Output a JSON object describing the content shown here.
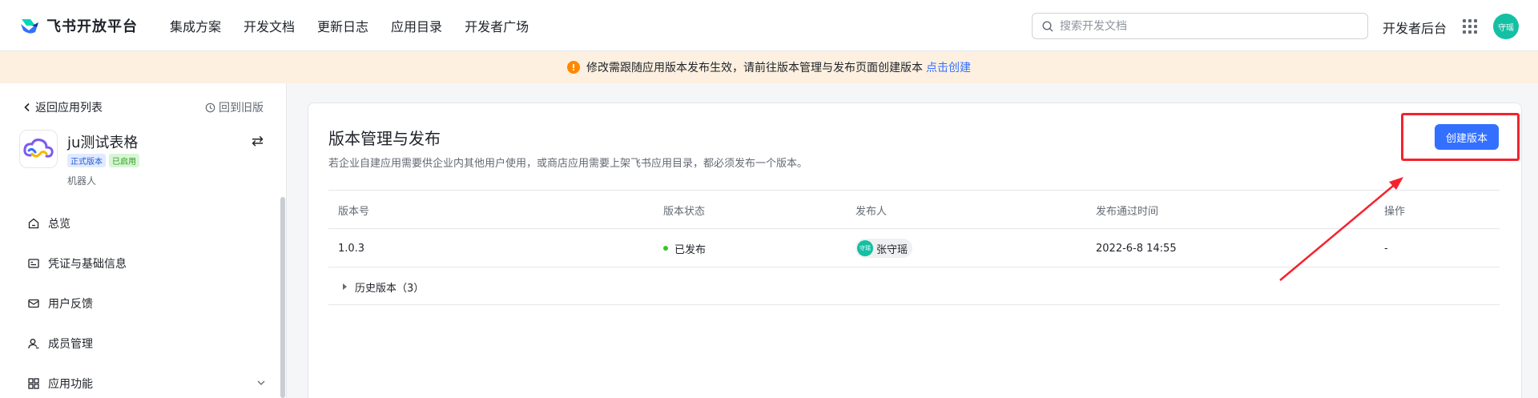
{
  "topbar": {
    "brand": "飞书开放平台",
    "nav": [
      "集成方案",
      "开发文档",
      "更新日志",
      "应用目录",
      "开发者广场"
    ],
    "search_placeholder": "搜索开发文档",
    "dev_console": "开发者后台",
    "avatar_text": "守瑶"
  },
  "notice": {
    "text": "修改需跟随应用版本发布生效，请前往版本管理与发布页面创建版本",
    "link": "点击创建",
    "icon": "warning-icon",
    "color": "#ff8800"
  },
  "sidebar": {
    "back_label": "返回应用列表",
    "old_version_label": "回到旧版",
    "app_name": "ju测试表格",
    "tag_official": "正式版本",
    "tag_enabled": "已启用",
    "app_type": "机器人",
    "menu": [
      {
        "label": "总览",
        "icon": "home-icon"
      },
      {
        "label": "凭证与基础信息",
        "icon": "credential-icon"
      },
      {
        "label": "用户反馈",
        "icon": "mail-icon"
      },
      {
        "label": "成员管理",
        "icon": "user-icon"
      },
      {
        "label": "应用功能",
        "icon": "apps-icon"
      }
    ]
  },
  "main": {
    "title": "版本管理与发布",
    "description": "若企业自建应用需要供企业内其他用户使用，或商店应用需要上架飞书应用目录，都必须发布一个版本。",
    "create_button": "创建版本",
    "table": {
      "headers": [
        "版本号",
        "版本状态",
        "发布人",
        "发布通过时间",
        "操作"
      ],
      "rows": [
        {
          "version": "1.0.3",
          "status": "已发布",
          "publisher": "张守瑶",
          "publisher_avatar": "守瑶",
          "time": "2022-6-8 14:55",
          "action": "-"
        }
      ],
      "history_label": "历史版本（3）"
    }
  },
  "colors": {
    "primary": "#3370ff",
    "annotation": "#f5222d",
    "success": "#34c724",
    "avatar": "#14c0a4"
  }
}
